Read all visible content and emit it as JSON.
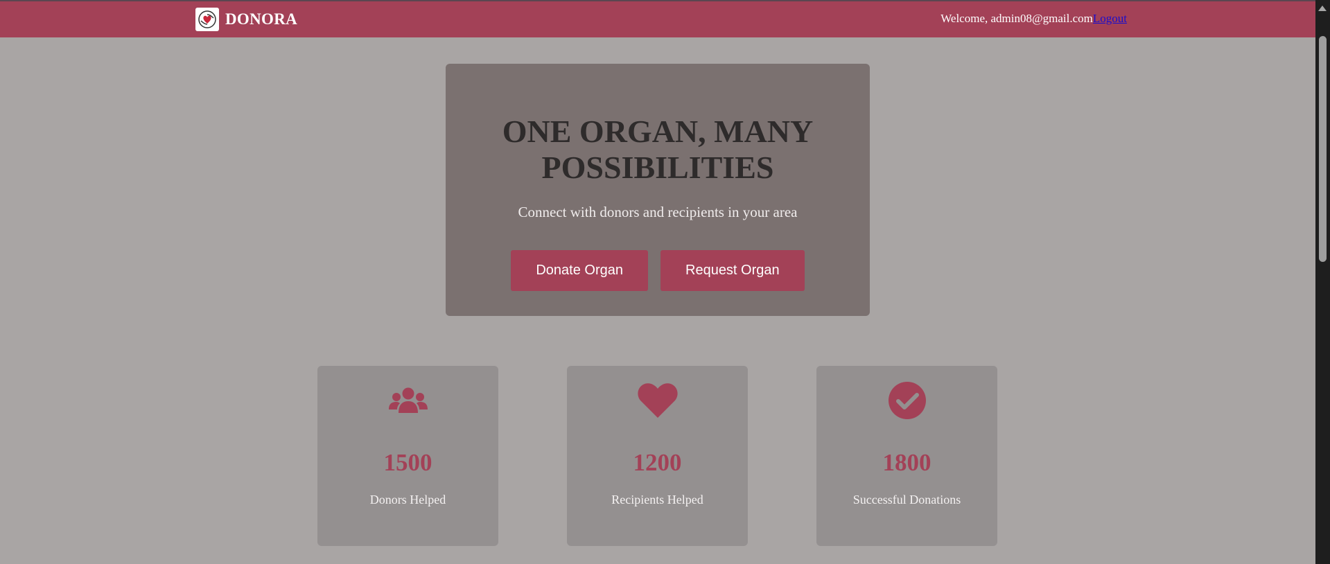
{
  "navbar": {
    "brand_name": "DONORA",
    "welcome_text": "Welcome, admin08@gmail.com",
    "logout_label": "Logout"
  },
  "hero": {
    "title_line1": "ONE ORGAN, MANY",
    "title_line2": "POSSIBILITIES",
    "subtitle": "Connect with donors and recipients in your area",
    "donate_label": "Donate Organ",
    "request_label": "Request Organ"
  },
  "stats": [
    {
      "icon": "users-icon",
      "value": "1500",
      "label": "Donors Helped"
    },
    {
      "icon": "heart-icon",
      "value": "1200",
      "label": "Recipients Helped"
    },
    {
      "icon": "check-circle-icon",
      "value": "1800",
      "label": "Successful Donations"
    }
  ],
  "colors": {
    "brand": "#a34157",
    "background": "#a9a5a4",
    "hero_bg": "#7b7170",
    "card_bg": "#949090"
  }
}
